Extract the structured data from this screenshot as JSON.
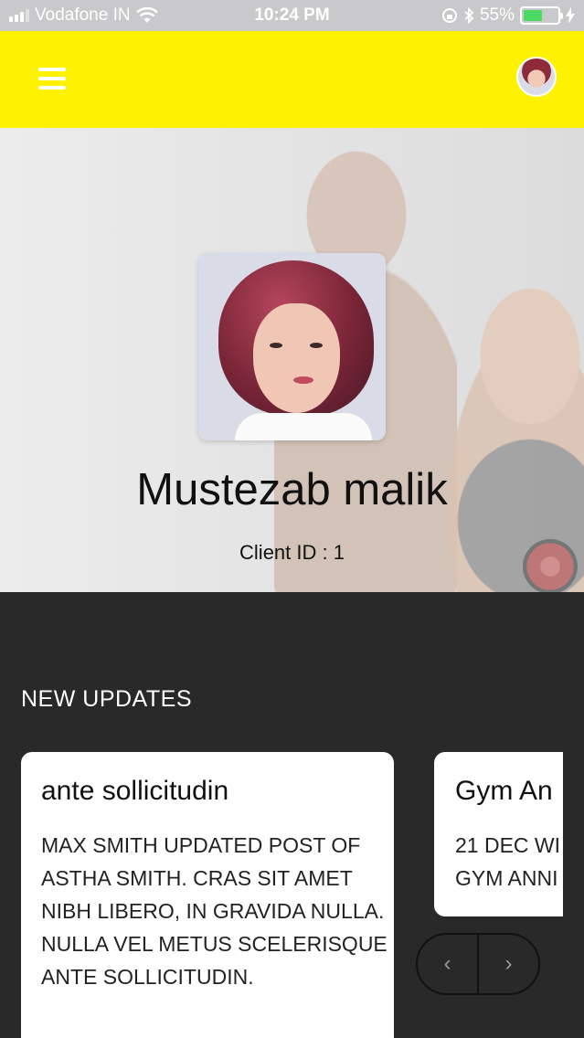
{
  "status_bar": {
    "carrier": "Vodafone IN",
    "time": "10:24 PM",
    "battery": "55%",
    "battery_level": 0.55
  },
  "header": {
    "menu_icon": "hamburger-menu-icon",
    "avatar_icon": "user-avatar"
  },
  "profile": {
    "name": "Mustezab malik",
    "client_id": "Client ID : 1"
  },
  "updates": {
    "title": "NEW UPDATES",
    "cards": [
      {
        "title": "ante sollicitudin",
        "body": "MAX SMITH UPDATED POST OF ASTHA SMITH. CRAS SIT AMET NIBH LIBERO, IN GRAVIDA NULLA. NULLA VEL METUS SCELERISQUE ANTE SOLLICITUDIN."
      },
      {
        "title": "Gym An",
        "body_line1": "21 DEC WI",
        "body_line2": "GYM ANNI"
      }
    ],
    "prev_symbol": "‹",
    "next_symbol": "›"
  },
  "colors": {
    "header_bg": "#fff200",
    "page_bg": "#2a292a",
    "card_bg": "#ffffff"
  }
}
